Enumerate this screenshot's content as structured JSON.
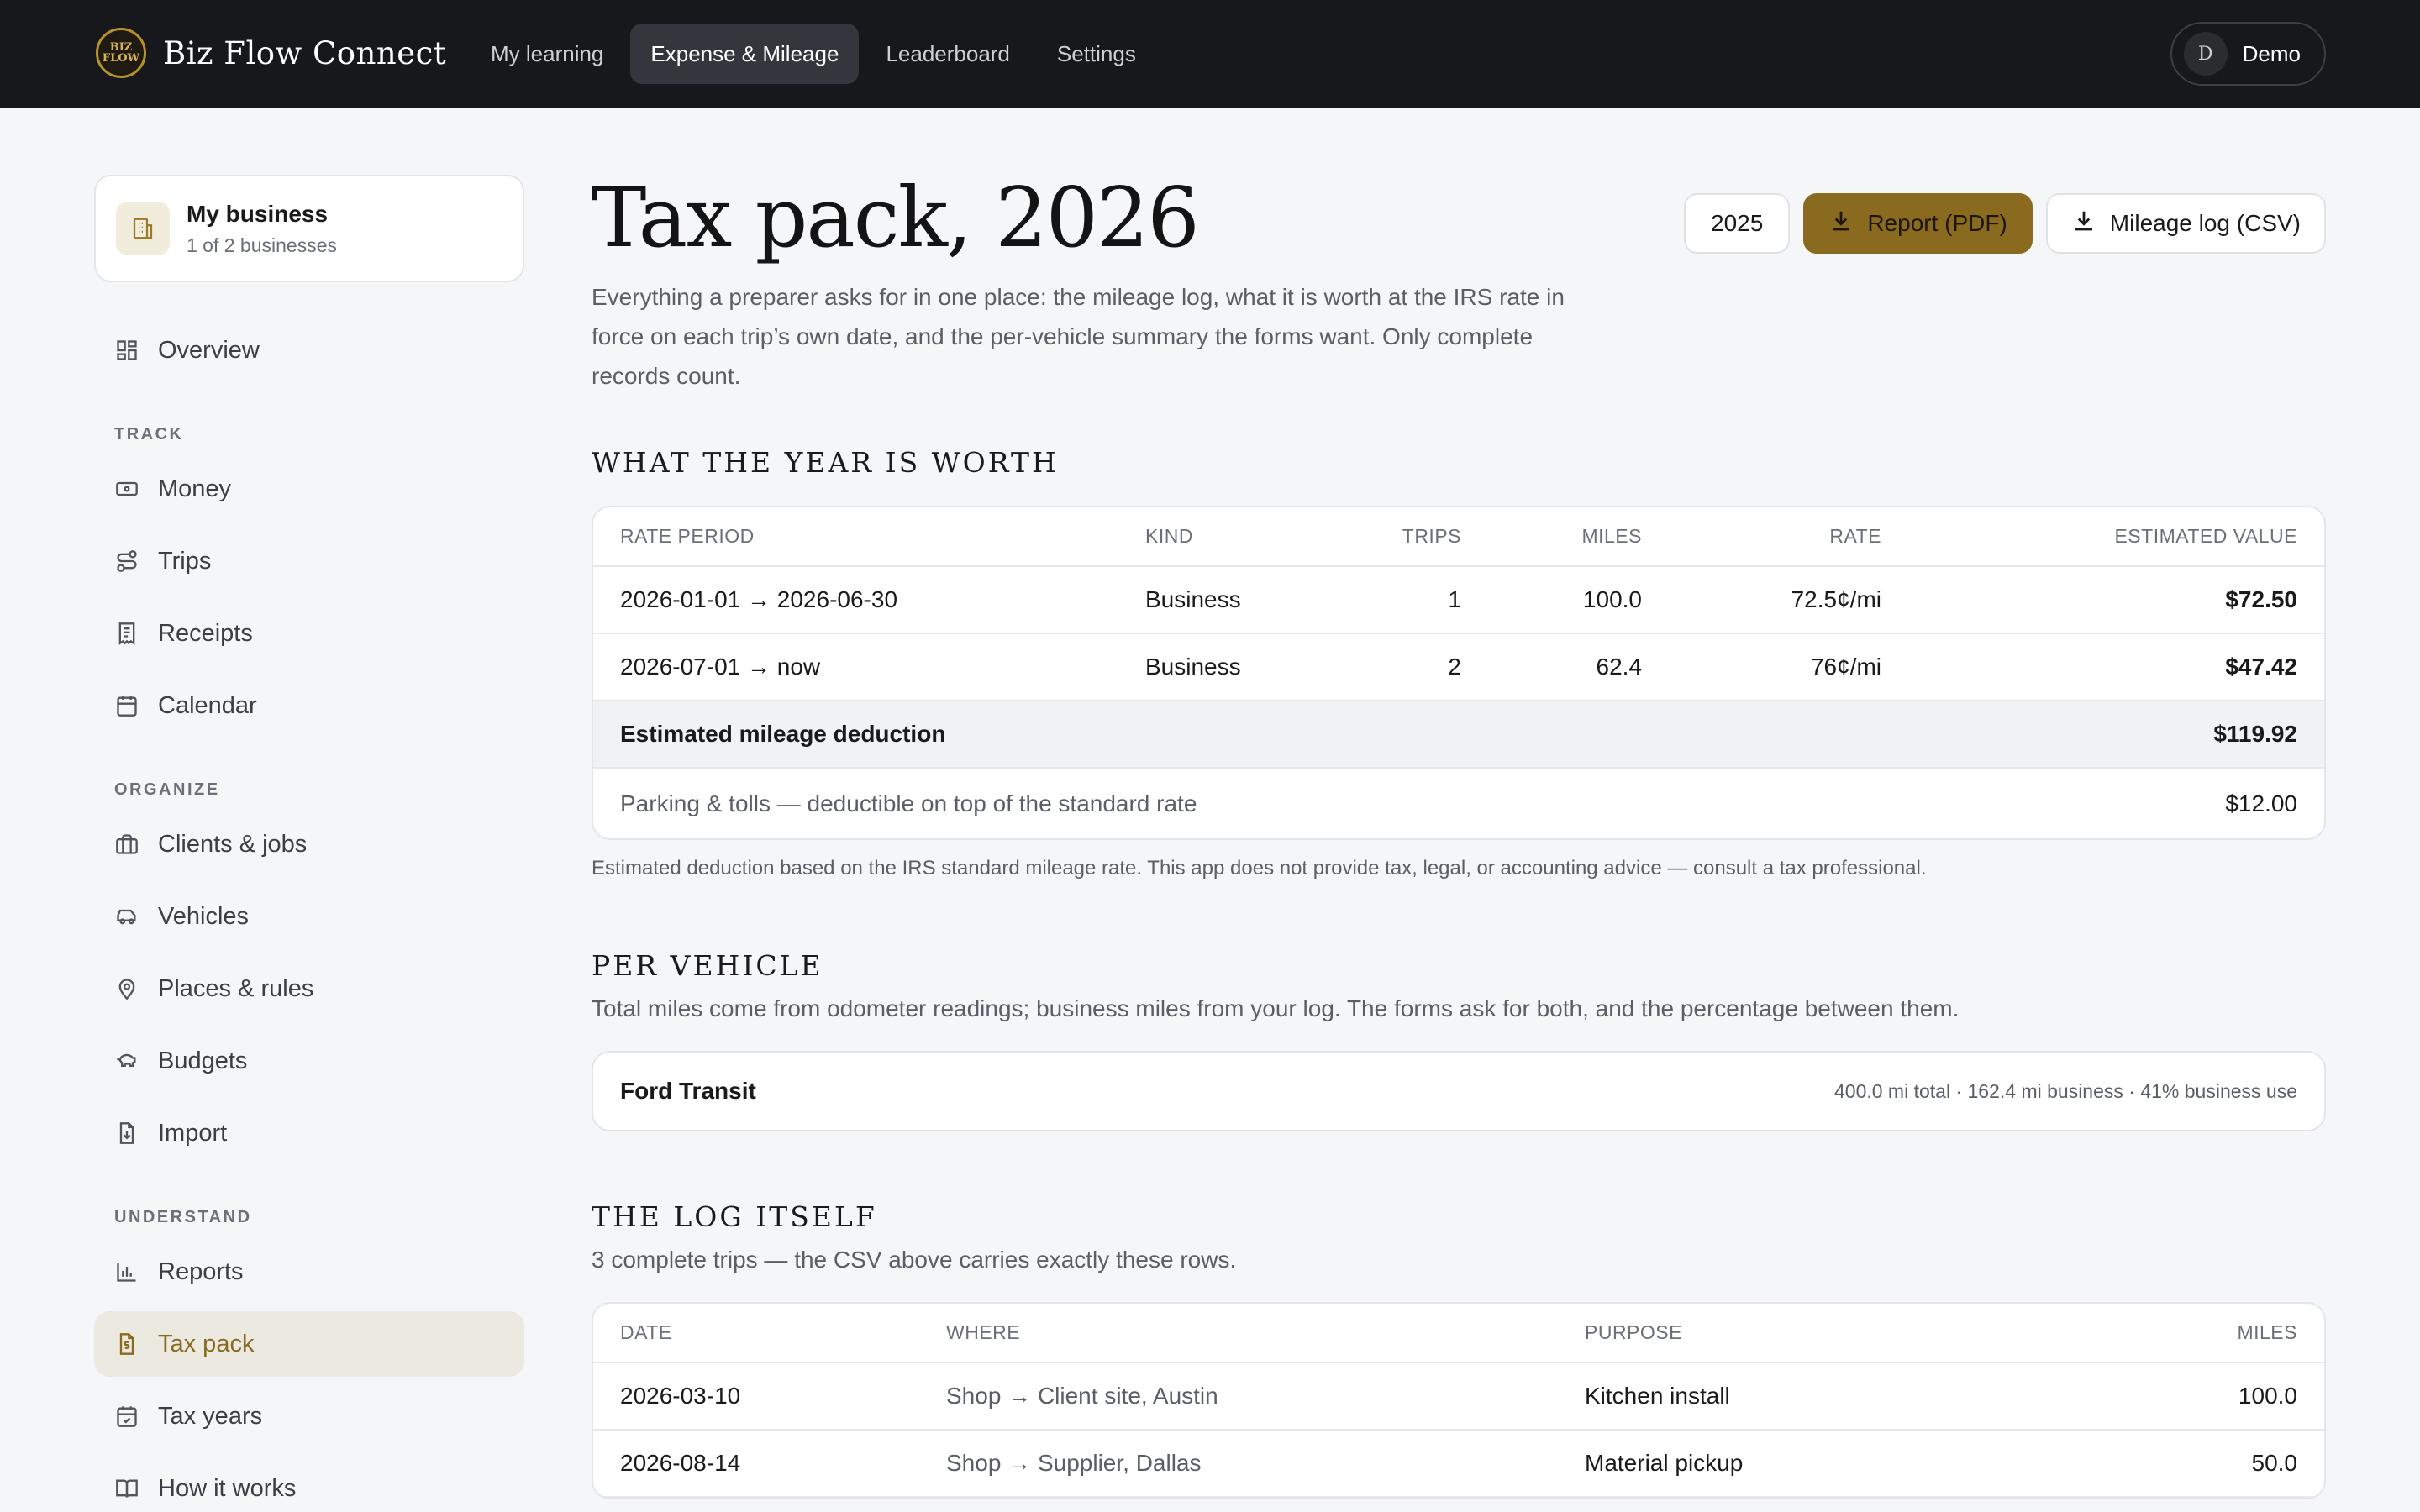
{
  "app": {
    "name": "Biz Flow Connect",
    "logo_text": "BIZ FLOW"
  },
  "nav": {
    "items": [
      {
        "label": "My learning"
      },
      {
        "label": "Expense & Mileage",
        "active": true
      },
      {
        "label": "Leaderboard"
      },
      {
        "label": "Settings"
      }
    ]
  },
  "user": {
    "initial": "D",
    "name": "Demo"
  },
  "business": {
    "title": "My business",
    "subtitle": "1 of 2 businesses"
  },
  "sidebar": {
    "overview": "Overview",
    "track_label": "TRACK",
    "track": [
      "Money",
      "Trips",
      "Receipts",
      "Calendar"
    ],
    "organize_label": "ORGANIZE",
    "organize": [
      "Clients & jobs",
      "Vehicles",
      "Places & rules",
      "Budgets",
      "Import"
    ],
    "understand_label": "UNDERSTAND",
    "understand": [
      "Reports",
      "Tax pack",
      "Tax years",
      "How it works"
    ],
    "active": "Tax pack"
  },
  "page": {
    "title": "Tax pack, 2026",
    "intro": "Everything a preparer asks for in one place: the mileage log, what it is worth at the IRS rate in force on each trip’s own date, and the per-vehicle summary the forms want. Only complete records count.",
    "year_button": "2025",
    "report_button": "Report (PDF)",
    "mileage_button": "Mileage log (CSV)"
  },
  "worth": {
    "heading": "What the year is worth",
    "columns": [
      "RATE PERIOD",
      "KIND",
      "TRIPS",
      "MILES",
      "RATE",
      "ESTIMATED VALUE"
    ],
    "rows": [
      {
        "period": "2026-01-01 → 2026-06-30",
        "kind": "Business",
        "trips": "1",
        "miles": "100.0",
        "rate": "72.5¢/mi",
        "value": "$72.50"
      },
      {
        "period": "2026-07-01 → now",
        "kind": "Business",
        "trips": "2",
        "miles": "62.4",
        "rate": "76¢/mi",
        "value": "$47.42"
      }
    ],
    "total_label": "Estimated mileage deduction",
    "total_value": "$119.92",
    "parking_label": "Parking & tolls — deductible on top of the standard rate",
    "parking_value": "$12.00",
    "disclaimer": "Estimated deduction based on the IRS standard mileage rate. This app does not provide tax, legal, or accounting advice — consult a tax professional."
  },
  "vehicle": {
    "heading": "Per vehicle",
    "subtitle": "Total miles come from odometer readings; business miles from your log. The forms ask for both, and the percentage between them.",
    "name": "Ford Transit",
    "stats": "400.0 mi total · 162.4 mi business · 41% business use"
  },
  "log": {
    "heading": "The log itself",
    "subtitle": "3 complete trips — the CSV above carries exactly these rows.",
    "columns": [
      "DATE",
      "WHERE",
      "PURPOSE",
      "MILES"
    ],
    "rows": [
      {
        "date": "2026-03-10",
        "where": "Shop → Client site, Austin",
        "purpose": "Kitchen install",
        "miles": "100.0"
      },
      {
        "date": "2026-08-14",
        "where": "Shop → Supplier, Dallas",
        "purpose": "Material pickup",
        "miles": "50.0"
      }
    ]
  }
}
